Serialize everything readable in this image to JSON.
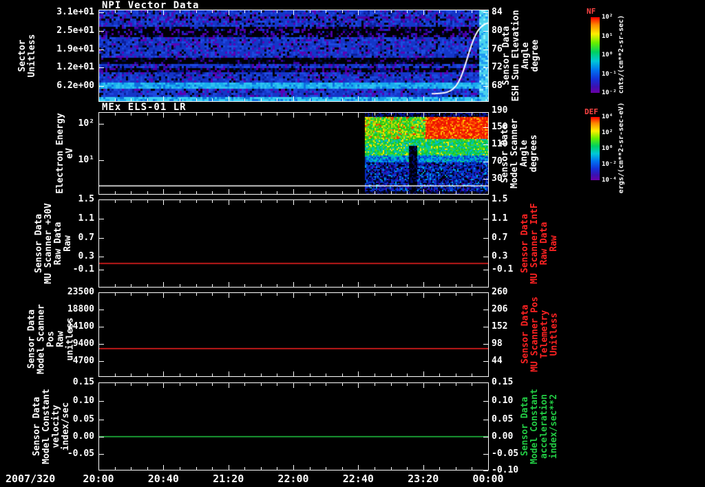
{
  "colors": {
    "background": "#000000",
    "axis": "#ffffff",
    "red_series": "#ff2222",
    "green_series": "#22cc44",
    "colorbar_title": "#ff4444"
  },
  "panels": [
    {
      "title": "NPI Vector Data",
      "left_label": "Sector\nUnitless",
      "left_ticks": [
        "3.1e+01",
        "2.5e+01",
        "1.9e+01",
        "1.2e+01",
        "6.2e+00"
      ],
      "right_ticks": [
        "84",
        "80",
        "76",
        "72",
        "68"
      ],
      "right_label": "Sensor Data\nESH Sun Elevation\nAngle\ndegree",
      "colorbar": {
        "title": "NF",
        "ticks": [
          "10²",
          "10¹",
          "10⁰",
          "10⁻¹",
          "10⁻²"
        ],
        "units": "cnts/(cm**2-sr-sec)"
      }
    },
    {
      "title": "MEx ELS-01 LR",
      "left_label": "Electron Energy\neV",
      "left_ticks": [
        "10²",
        "10¹"
      ],
      "right_ticks": [
        "190",
        "150",
        "110",
        "70",
        "30"
      ],
      "right_label": "Sensor Data\nModel Scanner\nAngle\ndegrees",
      "colorbar": {
        "title": "DEF",
        "ticks": [
          "10⁴",
          "10²",
          "10⁰",
          "10⁻²",
          "10⁻⁴"
        ],
        "units": "ergs/(cm**2-sr-sec-eV)"
      }
    },
    {
      "title": "",
      "left_label": "Sensor Data\nMU Scanner +30V\nRaw Data\nRaw",
      "left_ticks": [
        "1.5",
        "1.1",
        "0.7",
        "0.3",
        "-0.1"
      ],
      "right_ticks": [
        "1.5",
        "1.1",
        "0.7",
        "0.3",
        "-0.1"
      ],
      "right_label": "Sensor Data\nMU Scanner IntF\nRaw Data\nRaw",
      "right_label_color": "#ff2222"
    },
    {
      "title": "",
      "left_label": "Sensor Data\nModel Scanner Pos\nRaw\nunitless",
      "left_ticks": [
        "23500",
        "18800",
        "14100",
        "9400",
        "4700"
      ],
      "right_ticks": [
        "260",
        "206",
        "152",
        "98",
        "44"
      ],
      "right_label": "Sensor Data\nMU Scanner Pos\nTelemetry\nUnitless",
      "right_label_color": "#ff2222"
    },
    {
      "title": "",
      "left_label": "Sensor Data\nModel Constant\nvelocity\nindex/sec",
      "left_ticks": [
        "0.15",
        "0.10",
        "0.05",
        "0.00",
        "-0.05"
      ],
      "right_ticks": [
        "0.15",
        "0.10",
        "0.05",
        "0.00",
        "-0.05",
        "-0.10"
      ],
      "right_label": "Sensor Data\nModel Constant\nacceleration\nindex/sec**2",
      "right_label_color": "#22cc44"
    }
  ],
  "x_axis": {
    "date_label": "2007/320",
    "tick_labels": [
      "20:00",
      "20:40",
      "21:20",
      "22:00",
      "22:40",
      "23:20",
      "00:00"
    ]
  },
  "chart_data": [
    {
      "type": "heatmap",
      "title": "NPI Vector Data",
      "ylabel": "Sector (Unitless)",
      "yticks": [
        "3.1e+01",
        "2.5e+01",
        "1.9e+01",
        "1.2e+01",
        "6.2e+00"
      ],
      "right_ylabel": "Sensor Data ESH Sun Elevation Angle (degree)",
      "right_yticks": [
        84,
        80,
        76,
        72,
        68
      ],
      "x_start": "2007/320 20:00",
      "x_end": "2007/321 00:00",
      "x_ticks": [
        "20:00",
        "20:40",
        "21:20",
        "22:00",
        "22:40",
        "23:20",
        "00:00"
      ],
      "colorbar_label": "NF",
      "colorbar_units": "cnts/(cm**2-sr-sec)",
      "features": [
        "moderate blue counts across all sectors for the full interval with purple/black speckle noise",
        "dark low-count horizontal bands near sectors ~19-24 and near sector ~12",
        "bright cyan high-count bands at the lowest sectors",
        "white overlay curve (sun elevation) flat near 68 deg then rising steeply to ~84 deg between ~23:30 and 00:00"
      ]
    },
    {
      "type": "heatmap",
      "title": "MEx ELS-01 LR",
      "ylabel": "Electron Energy (eV)",
      "yscale": "log",
      "yticks": [
        "10²",
        "10¹"
      ],
      "right_ylabel": "Sensor Data Model Scanner Angle (degrees)",
      "right_yticks": [
        190,
        150,
        110,
        70,
        30
      ],
      "x_start": "2007/320 20:00",
      "x_end": "2007/321 00:00",
      "colorbar_label": "DEF",
      "colorbar_units": "ergs/(cm**2-sr-sec-eV)",
      "features": [
        "no data (black) from 20:00 until about 22:45",
        "green/yellow flux at ~20-200 eV starting ~22:45",
        "intense red flux at ~30-200 eV from ~23:15 to 00:00",
        "low blue/dark flux below ~10 eV with a dark vertical gap near 23:10",
        "white horizontal marker line near the bottom of the panel"
      ]
    },
    {
      "type": "line",
      "ylabel": "Sensor Data MU Scanner +30V Raw Data (Raw)",
      "right_ylabel": "Sensor Data MU Scanner IntF Raw Data (Raw)",
      "yticks": [
        1.5,
        1.1,
        0.7,
        0.3,
        -0.1
      ],
      "ylim": [
        -0.5,
        1.5
      ],
      "series": [
        {
          "name": "MU Scanner +30V Raw Data",
          "color": "#ff2222",
          "constant_value": 0.05
        }
      ]
    },
    {
      "type": "line",
      "ylabel": "Sensor Data Model Scanner Pos Raw (unitless)",
      "right_ylabel": "Sensor Data MU Scanner Pos Telemetry (Unitless)",
      "yticks": [
        23500,
        18800,
        14100,
        9400,
        4700
      ],
      "right_yticks": [
        260,
        206,
        152,
        98,
        44
      ],
      "ylim": [
        0,
        23500
      ],
      "series": [
        {
          "name": "Model Scanner Pos Raw",
          "color": "#ff2222",
          "constant_value": 8200
        }
      ]
    },
    {
      "type": "line",
      "ylabel": "Sensor Data Model Constant velocity (index/sec)",
      "right_ylabel": "Sensor Data Model Constant acceleration (index/sec**2)",
      "yticks": [
        0.15,
        0.1,
        0.05,
        0.0,
        -0.05,
        -0.1
      ],
      "ylim": [
        -0.1,
        0.15
      ],
      "series": [
        {
          "name": "Model Constant velocity",
          "color": "#22cc44",
          "constant_value": 0.0
        }
      ]
    }
  ]
}
